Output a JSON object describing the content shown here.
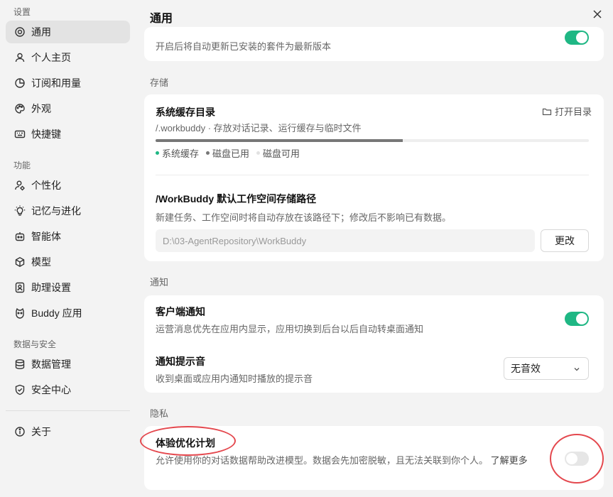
{
  "sidebar": {
    "sections": [
      {
        "title": "设置",
        "items": [
          {
            "label": "通用",
            "icon": "target-icon",
            "active": true
          },
          {
            "label": "个人主页",
            "icon": "user-icon"
          },
          {
            "label": "订阅和用量",
            "icon": "pie-chart-icon"
          },
          {
            "label": "外观",
            "icon": "palette-icon"
          },
          {
            "label": "快捷键",
            "icon": "keyboard-icon"
          }
        ]
      },
      {
        "title": "功能",
        "items": [
          {
            "label": "个性化",
            "icon": "user-settings-icon"
          },
          {
            "label": "记忆与进化",
            "icon": "lightbulb-icon"
          },
          {
            "label": "智能体",
            "icon": "robot-icon"
          },
          {
            "label": "模型",
            "icon": "cube-icon"
          },
          {
            "label": "助理设置",
            "icon": "assistant-icon"
          },
          {
            "label": "Buddy 应用",
            "icon": "buddy-icon"
          }
        ]
      },
      {
        "title": "数据与安全",
        "items": [
          {
            "label": "数据管理",
            "icon": "database-icon"
          },
          {
            "label": "安全中心",
            "icon": "shield-check-icon"
          }
        ]
      }
    ],
    "footer_item": {
      "label": "关于",
      "icon": "info-icon"
    }
  },
  "header": {
    "title": "通用",
    "close_icon": "close-icon"
  },
  "auto_update": {
    "desc": "开启后将自动更新已安装的套件为最新版本",
    "enabled": true
  },
  "storage": {
    "group_label": "存储",
    "cache": {
      "title": "系统缓存目录",
      "open_dir_label": "打开目录",
      "desc": "/.workbuddy · 存放对话记录、运行缓存与临时文件",
      "usage_fraction": 0.57,
      "legend": [
        {
          "label": "系统缓存",
          "color": "#1fb784"
        },
        {
          "label": "磁盘已用",
          "color": "#777777"
        },
        {
          "label": "磁盘可用",
          "color": "#e2e2e2"
        }
      ]
    },
    "workspace": {
      "title": "/WorkBuddy 默认工作空间存储路径",
      "desc": "新建任务、工作空间时将自动存放在该路径下；修改后不影响已有数据。",
      "path_value": "D:\\03-AgentRepository\\WorkBuddy",
      "change_label": "更改"
    }
  },
  "notify": {
    "group_label": "通知",
    "client": {
      "title": "客户端通知",
      "desc": "运营消息优先在应用内显示，应用切换到后台以后自动转桌面通知",
      "enabled": true
    },
    "sound": {
      "title": "通知提示音",
      "desc": "收到桌面或应用内通知时播放的提示音",
      "selected": "无音效"
    }
  },
  "privacy": {
    "group_label": "隐私",
    "experience": {
      "title": "体验优化计划",
      "desc": "允许使用你的对话数据帮助改进模型。数据会先加密脱敏，且无法关联到你个人。",
      "learn_more": "了解更多",
      "enabled": false
    }
  },
  "colors": {
    "accent": "#1fb784",
    "annotation": "#e4484e"
  }
}
